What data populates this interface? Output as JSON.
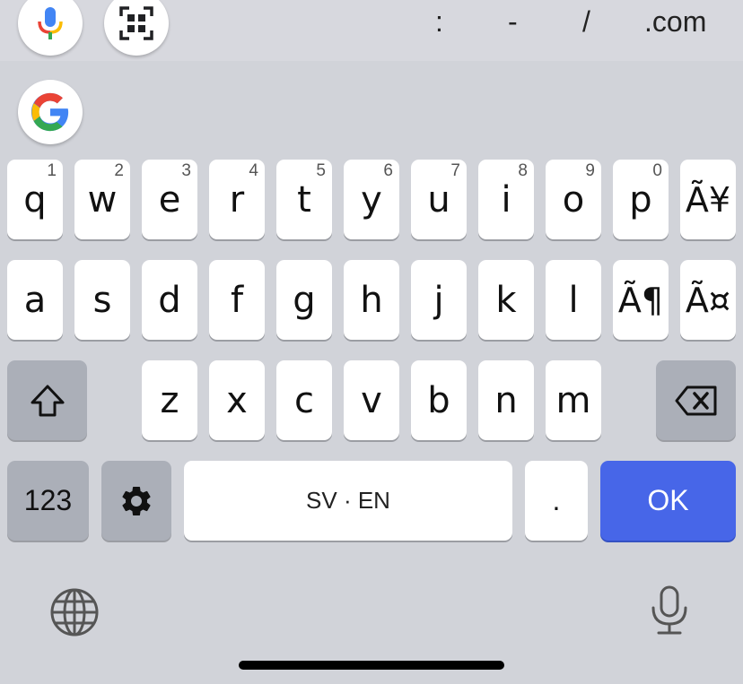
{
  "toolbar": {
    "symbols": [
      ":",
      "-",
      "/",
      ".com"
    ],
    "icons": [
      "google-voice-icon",
      "scan-qr-icon",
      "google-g-icon"
    ]
  },
  "keyboard": {
    "row1": [
      {
        "label": "q",
        "hint": "1"
      },
      {
        "label": "w",
        "hint": "2"
      },
      {
        "label": "e",
        "hint": "3"
      },
      {
        "label": "r",
        "hint": "4"
      },
      {
        "label": "t",
        "hint": "5"
      },
      {
        "label": "y",
        "hint": "6"
      },
      {
        "label": "u",
        "hint": "7"
      },
      {
        "label": "i",
        "hint": "8"
      },
      {
        "label": "o",
        "hint": "9"
      },
      {
        "label": "p",
        "hint": "0"
      },
      {
        "label": "Ã¥",
        "hint": ""
      }
    ],
    "row2": [
      {
        "label": "a"
      },
      {
        "label": "s"
      },
      {
        "label": "d"
      },
      {
        "label": "f"
      },
      {
        "label": "g"
      },
      {
        "label": "h"
      },
      {
        "label": "j"
      },
      {
        "label": "k"
      },
      {
        "label": "l"
      },
      {
        "label": "Ã¶"
      },
      {
        "label": "Ã¤"
      }
    ],
    "row3": [
      {
        "label": "z"
      },
      {
        "label": "x"
      },
      {
        "label": "c"
      },
      {
        "label": "v"
      },
      {
        "label": "b"
      },
      {
        "label": "n"
      },
      {
        "label": "m"
      }
    ],
    "numbers_label": "123",
    "space_label": "SV · EN",
    "period_label": ".",
    "ok_label": "OK"
  },
  "colors": {
    "background": "#d1d3d9",
    "key": "#ffffff",
    "special_key": "#abafb8",
    "action_key": "#4766e8"
  }
}
